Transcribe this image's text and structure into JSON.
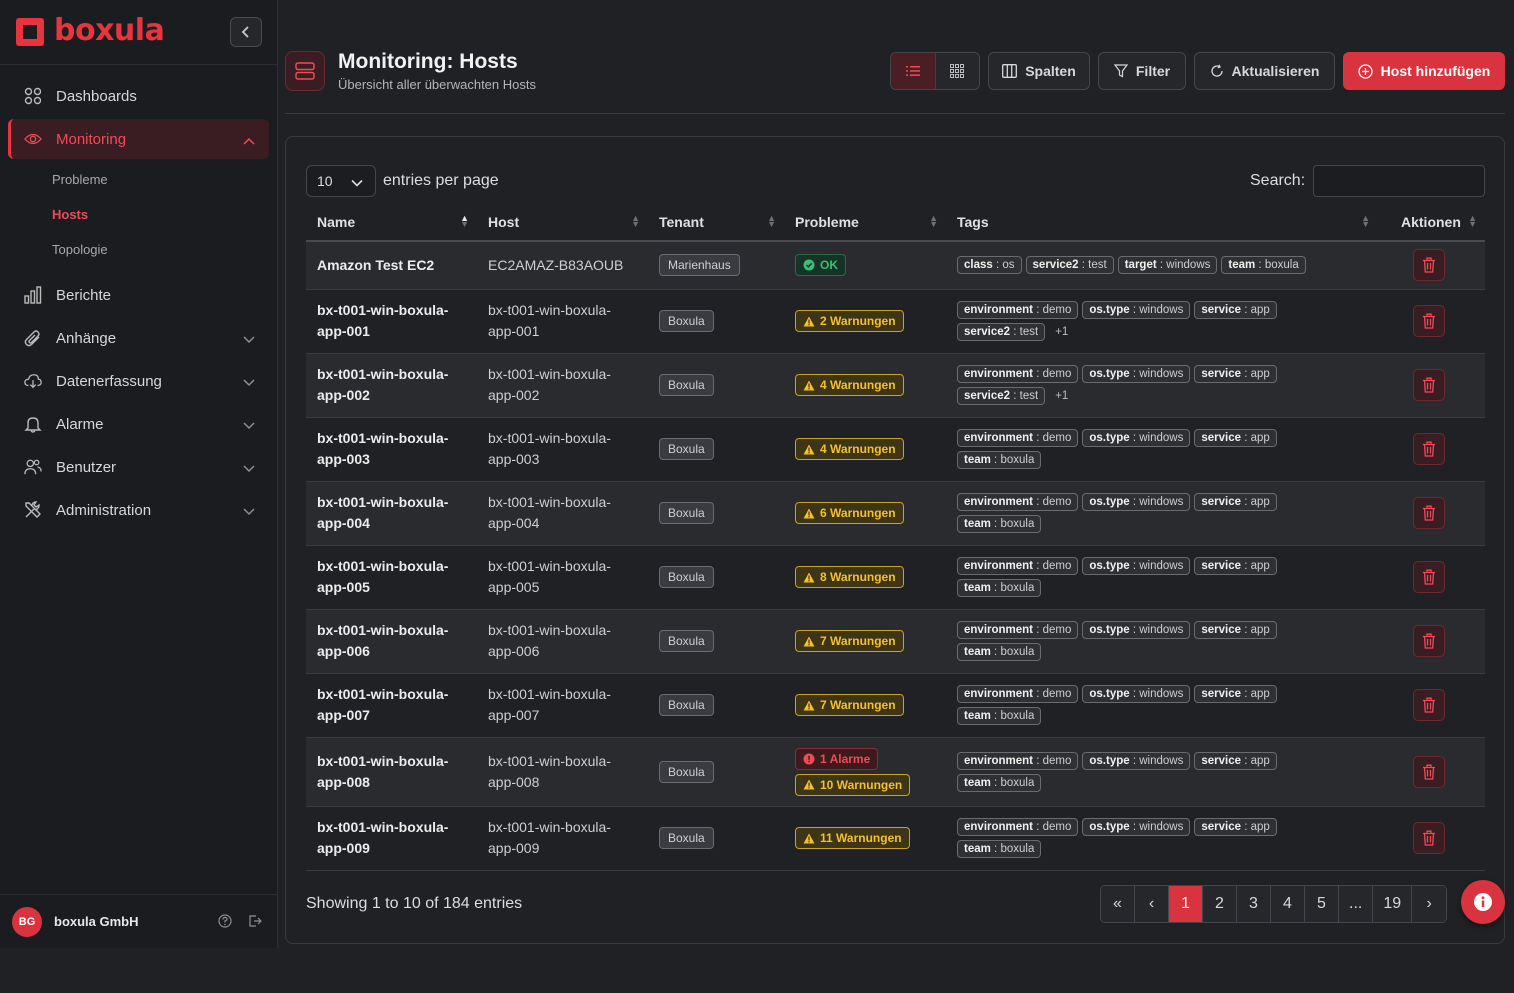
{
  "brand": {
    "name": "boxula",
    "accent": "#e8343f"
  },
  "sidebar": {
    "items": [
      {
        "label": "Dashboards",
        "icon": "grid-icon"
      },
      {
        "label": "Monitoring",
        "icon": "eye-icon"
      },
      {
        "label": "Berichte",
        "icon": "bar-chart-icon"
      },
      {
        "label": "Anhänge",
        "icon": "paperclip-icon"
      },
      {
        "label": "Datenerfassung",
        "icon": "cloud-download-icon"
      },
      {
        "label": "Alarme",
        "icon": "bell-icon"
      },
      {
        "label": "Benutzer",
        "icon": "users-icon"
      },
      {
        "label": "Administration",
        "icon": "tools-icon"
      }
    ],
    "monitoring_sub": [
      "Probleme",
      "Hosts",
      "Topologie"
    ],
    "user": {
      "initials": "BG",
      "name": "boxula GmbH"
    }
  },
  "header": {
    "title": "Monitoring: Hosts",
    "subtitle": "Übersicht aller überwachten Hosts",
    "columns_label": "Spalten",
    "filter_label": "Filter",
    "refresh_label": "Aktualisieren",
    "add_label": "Host hinzufügen"
  },
  "table_controls": {
    "per_page_value": "10",
    "per_page_label": "entries per page",
    "search_label": "Search:",
    "search_value": ""
  },
  "columns": [
    "Name",
    "Host",
    "Tenant",
    "Probleme",
    "Tags",
    "Aktionen"
  ],
  "rows": [
    {
      "name": "Amazon Test EC2",
      "host": "EC2AMAZ-B83AOUB",
      "tenant": "Marienhaus",
      "problems": [
        {
          "type": "ok",
          "label": "OK"
        }
      ],
      "tags": [
        {
          "k": "class",
          "v": "os"
        },
        {
          "k": "service2",
          "v": "test"
        },
        {
          "k": "target",
          "v": "windows"
        },
        {
          "k": "team",
          "v": "boxula"
        }
      ],
      "more": ""
    },
    {
      "name": "bx-t001-win-boxula-app-001",
      "host": "bx-t001-win-boxula-app-001",
      "tenant": "Boxula",
      "problems": [
        {
          "type": "warn",
          "label": "2 Warnungen"
        }
      ],
      "tags": [
        {
          "k": "environment",
          "v": "demo"
        },
        {
          "k": "os.type",
          "v": "windows"
        },
        {
          "k": "service",
          "v": "app"
        },
        {
          "k": "service2",
          "v": "test"
        }
      ],
      "more": "+1"
    },
    {
      "name": "bx-t001-win-boxula-app-002",
      "host": "bx-t001-win-boxula-app-002",
      "tenant": "Boxula",
      "problems": [
        {
          "type": "warn",
          "label": "4 Warnungen"
        }
      ],
      "tags": [
        {
          "k": "environment",
          "v": "demo"
        },
        {
          "k": "os.type",
          "v": "windows"
        },
        {
          "k": "service",
          "v": "app"
        },
        {
          "k": "service2",
          "v": "test"
        }
      ],
      "more": "+1"
    },
    {
      "name": "bx-t001-win-boxula-app-003",
      "host": "bx-t001-win-boxula-app-003",
      "tenant": "Boxula",
      "problems": [
        {
          "type": "warn",
          "label": "4 Warnungen"
        }
      ],
      "tags": [
        {
          "k": "environment",
          "v": "demo"
        },
        {
          "k": "os.type",
          "v": "windows"
        },
        {
          "k": "service",
          "v": "app"
        },
        {
          "k": "team",
          "v": "boxula"
        }
      ],
      "more": ""
    },
    {
      "name": "bx-t001-win-boxula-app-004",
      "host": "bx-t001-win-boxula-app-004",
      "tenant": "Boxula",
      "problems": [
        {
          "type": "warn",
          "label": "6 Warnungen"
        }
      ],
      "tags": [
        {
          "k": "environment",
          "v": "demo"
        },
        {
          "k": "os.type",
          "v": "windows"
        },
        {
          "k": "service",
          "v": "app"
        },
        {
          "k": "team",
          "v": "boxula"
        }
      ],
      "more": ""
    },
    {
      "name": "bx-t001-win-boxula-app-005",
      "host": "bx-t001-win-boxula-app-005",
      "tenant": "Boxula",
      "problems": [
        {
          "type": "warn",
          "label": "8 Warnungen"
        }
      ],
      "tags": [
        {
          "k": "environment",
          "v": "demo"
        },
        {
          "k": "os.type",
          "v": "windows"
        },
        {
          "k": "service",
          "v": "app"
        },
        {
          "k": "team",
          "v": "boxula"
        }
      ],
      "more": ""
    },
    {
      "name": "bx-t001-win-boxula-app-006",
      "host": "bx-t001-win-boxula-app-006",
      "tenant": "Boxula",
      "problems": [
        {
          "type": "warn",
          "label": "7 Warnungen"
        }
      ],
      "tags": [
        {
          "k": "environment",
          "v": "demo"
        },
        {
          "k": "os.type",
          "v": "windows"
        },
        {
          "k": "service",
          "v": "app"
        },
        {
          "k": "team",
          "v": "boxula"
        }
      ],
      "more": ""
    },
    {
      "name": "bx-t001-win-boxula-app-007",
      "host": "bx-t001-win-boxula-app-007",
      "tenant": "Boxula",
      "problems": [
        {
          "type": "warn",
          "label": "7 Warnungen"
        }
      ],
      "tags": [
        {
          "k": "environment",
          "v": "demo"
        },
        {
          "k": "os.type",
          "v": "windows"
        },
        {
          "k": "service",
          "v": "app"
        },
        {
          "k": "team",
          "v": "boxula"
        }
      ],
      "more": ""
    },
    {
      "name": "bx-t001-win-boxula-app-008",
      "host": "bx-t001-win-boxula-app-008",
      "tenant": "Boxula",
      "problems": [
        {
          "type": "alarm",
          "label": "1 Alarme"
        },
        {
          "type": "warn",
          "label": "10 Warnungen"
        }
      ],
      "tags": [
        {
          "k": "environment",
          "v": "demo"
        },
        {
          "k": "os.type",
          "v": "windows"
        },
        {
          "k": "service",
          "v": "app"
        },
        {
          "k": "team",
          "v": "boxula"
        }
      ],
      "more": ""
    },
    {
      "name": "bx-t001-win-boxula-app-009",
      "host": "bx-t001-win-boxula-app-009",
      "tenant": "Boxula",
      "problems": [
        {
          "type": "warn",
          "label": "11 Warnungen"
        }
      ],
      "tags": [
        {
          "k": "environment",
          "v": "demo"
        },
        {
          "k": "os.type",
          "v": "windows"
        },
        {
          "k": "service",
          "v": "app"
        },
        {
          "k": "team",
          "v": "boxula"
        }
      ],
      "more": ""
    }
  ],
  "footer": {
    "showing": "Showing 1 to 10 of 184 entries",
    "pages": [
      "«",
      "‹",
      "1",
      "2",
      "3",
      "4",
      "5",
      "...",
      "19",
      "›"
    ],
    "active_page": "1"
  }
}
